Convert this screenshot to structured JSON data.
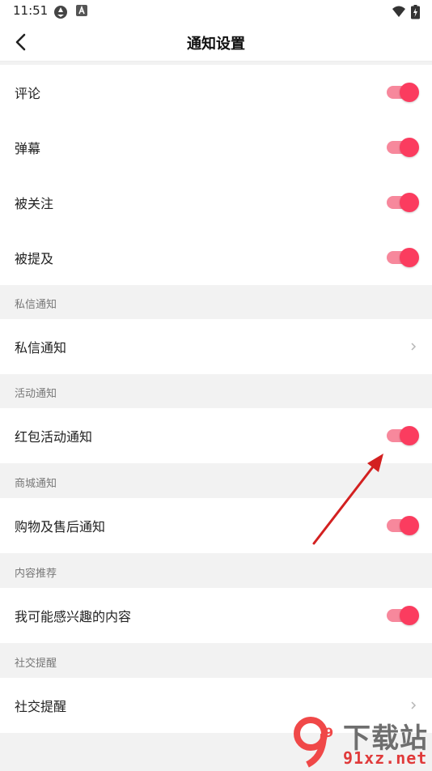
{
  "status_bar": {
    "time": "11:51"
  },
  "header": {
    "title": "通知设置"
  },
  "rows": [
    {
      "label": "评论",
      "toggle_on": true
    },
    {
      "label": "弹幕",
      "toggle_on": true
    },
    {
      "label": "被关注",
      "toggle_on": true
    },
    {
      "label": "被提及",
      "toggle_on": true
    }
  ],
  "sections": [
    {
      "header": "私信通知",
      "item": {
        "label": "私信通知",
        "control": "chevron"
      }
    },
    {
      "header": "活动通知",
      "item": {
        "label": "红包活动通知",
        "control": "toggle",
        "toggle_on": true
      }
    },
    {
      "header": "商城通知",
      "item": {
        "label": "购物及售后通知",
        "control": "toggle",
        "toggle_on": true
      }
    },
    {
      "header": "内容推荐",
      "item": {
        "label": "我可能感兴趣的内容",
        "control": "toggle",
        "toggle_on": true
      }
    },
    {
      "header": "社交提醒",
      "item": {
        "label": "社交提醒",
        "control": "chevron"
      }
    }
  ],
  "colors": {
    "accent": "#fb3c5f",
    "track": "#f7889c",
    "annotation_arrow": "#d32020"
  },
  "watermark": {
    "text": "下载站",
    "url": "91xz.net",
    "logo_text": "9"
  }
}
